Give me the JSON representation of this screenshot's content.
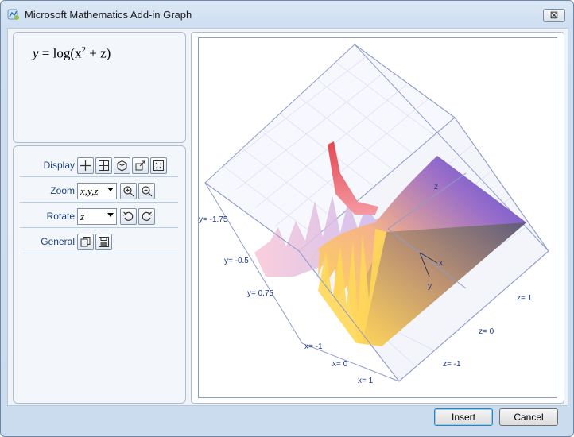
{
  "window": {
    "title": "Microsoft Mathematics Add-in Graph",
    "close_glyph": "⊠"
  },
  "formula": {
    "lhs": "y",
    "eq": " = ",
    "fn": "log",
    "open": "(x",
    "exp": "2",
    "rest": " + z)"
  },
  "controls": {
    "display": {
      "label": "Display",
      "icons": [
        "axes-icon",
        "grid-icon",
        "box-icon",
        "export-icon",
        "fit-icon"
      ]
    },
    "zoom": {
      "label": "Zoom",
      "value": "x,y,z"
    },
    "rotate": {
      "label": "Rotate",
      "value": "z"
    },
    "general": {
      "label": "General",
      "icons": [
        "copy-icon",
        "save-icon"
      ]
    }
  },
  "graph": {
    "axis_labels": {
      "y_neg175": "y= -1.75",
      "y_neg05": "y= -0.5",
      "y_075": "y= 0.75",
      "x_neg1": "x= -1",
      "x_0": "x= 0",
      "x_1": "x= 1",
      "z_neg1": "z= -1",
      "z_0": "z= 0",
      "z_1": "z= 1",
      "axis_x": "x",
      "axis_y": "y",
      "axis_z": "z"
    },
    "colors": {
      "low": "#ffd84a",
      "mid": "#f3a9c6",
      "high": "#5a5ad8",
      "spike": "#e05b62",
      "box": "#8f9cc9"
    }
  },
  "buttons": {
    "insert": "Insert",
    "cancel": "Cancel"
  }
}
